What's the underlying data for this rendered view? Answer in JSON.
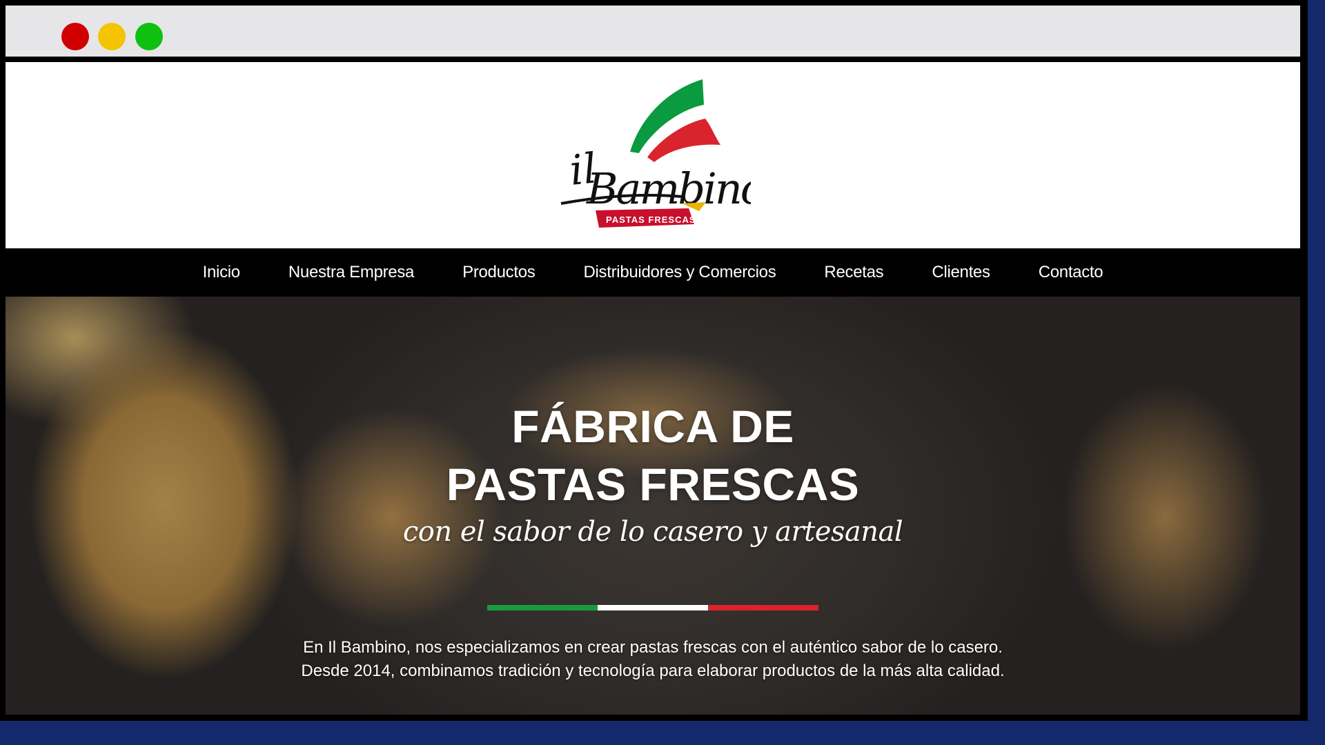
{
  "window": {
    "buttons": [
      "close",
      "minimize",
      "maximize"
    ]
  },
  "logo": {
    "script_text": "il Bambino",
    "ribbon_text": "PASTAS FRESCAS",
    "colors": {
      "green": "#0a9a3f",
      "red": "#d9232d",
      "ribbon": "#c8102e",
      "gold": "#e8b400",
      "ink": "#111111"
    }
  },
  "nav": {
    "items": [
      {
        "label": "Inicio"
      },
      {
        "label": "Nuestra Empresa"
      },
      {
        "label": "Productos"
      },
      {
        "label": "Distribuidores y Comercios"
      },
      {
        "label": "Recetas"
      },
      {
        "label": "Clientes"
      },
      {
        "label": "Contacto"
      }
    ]
  },
  "hero": {
    "title_line1": "FÁBRICA DE",
    "title_line2": "PASTAS FRESCAS",
    "tagline": "con el sabor de lo casero y artesanal",
    "description_line1": "En Il Bambino, nos especializamos en crear pastas frescas con el auténtico sabor de lo casero.",
    "description_line2": "Desde 2014, combinamos tradición y tecnología para elaborar productos de la más alta calidad.",
    "tricolor": [
      "#1a9a3e",
      "#ffffff",
      "#d9232d"
    ]
  }
}
